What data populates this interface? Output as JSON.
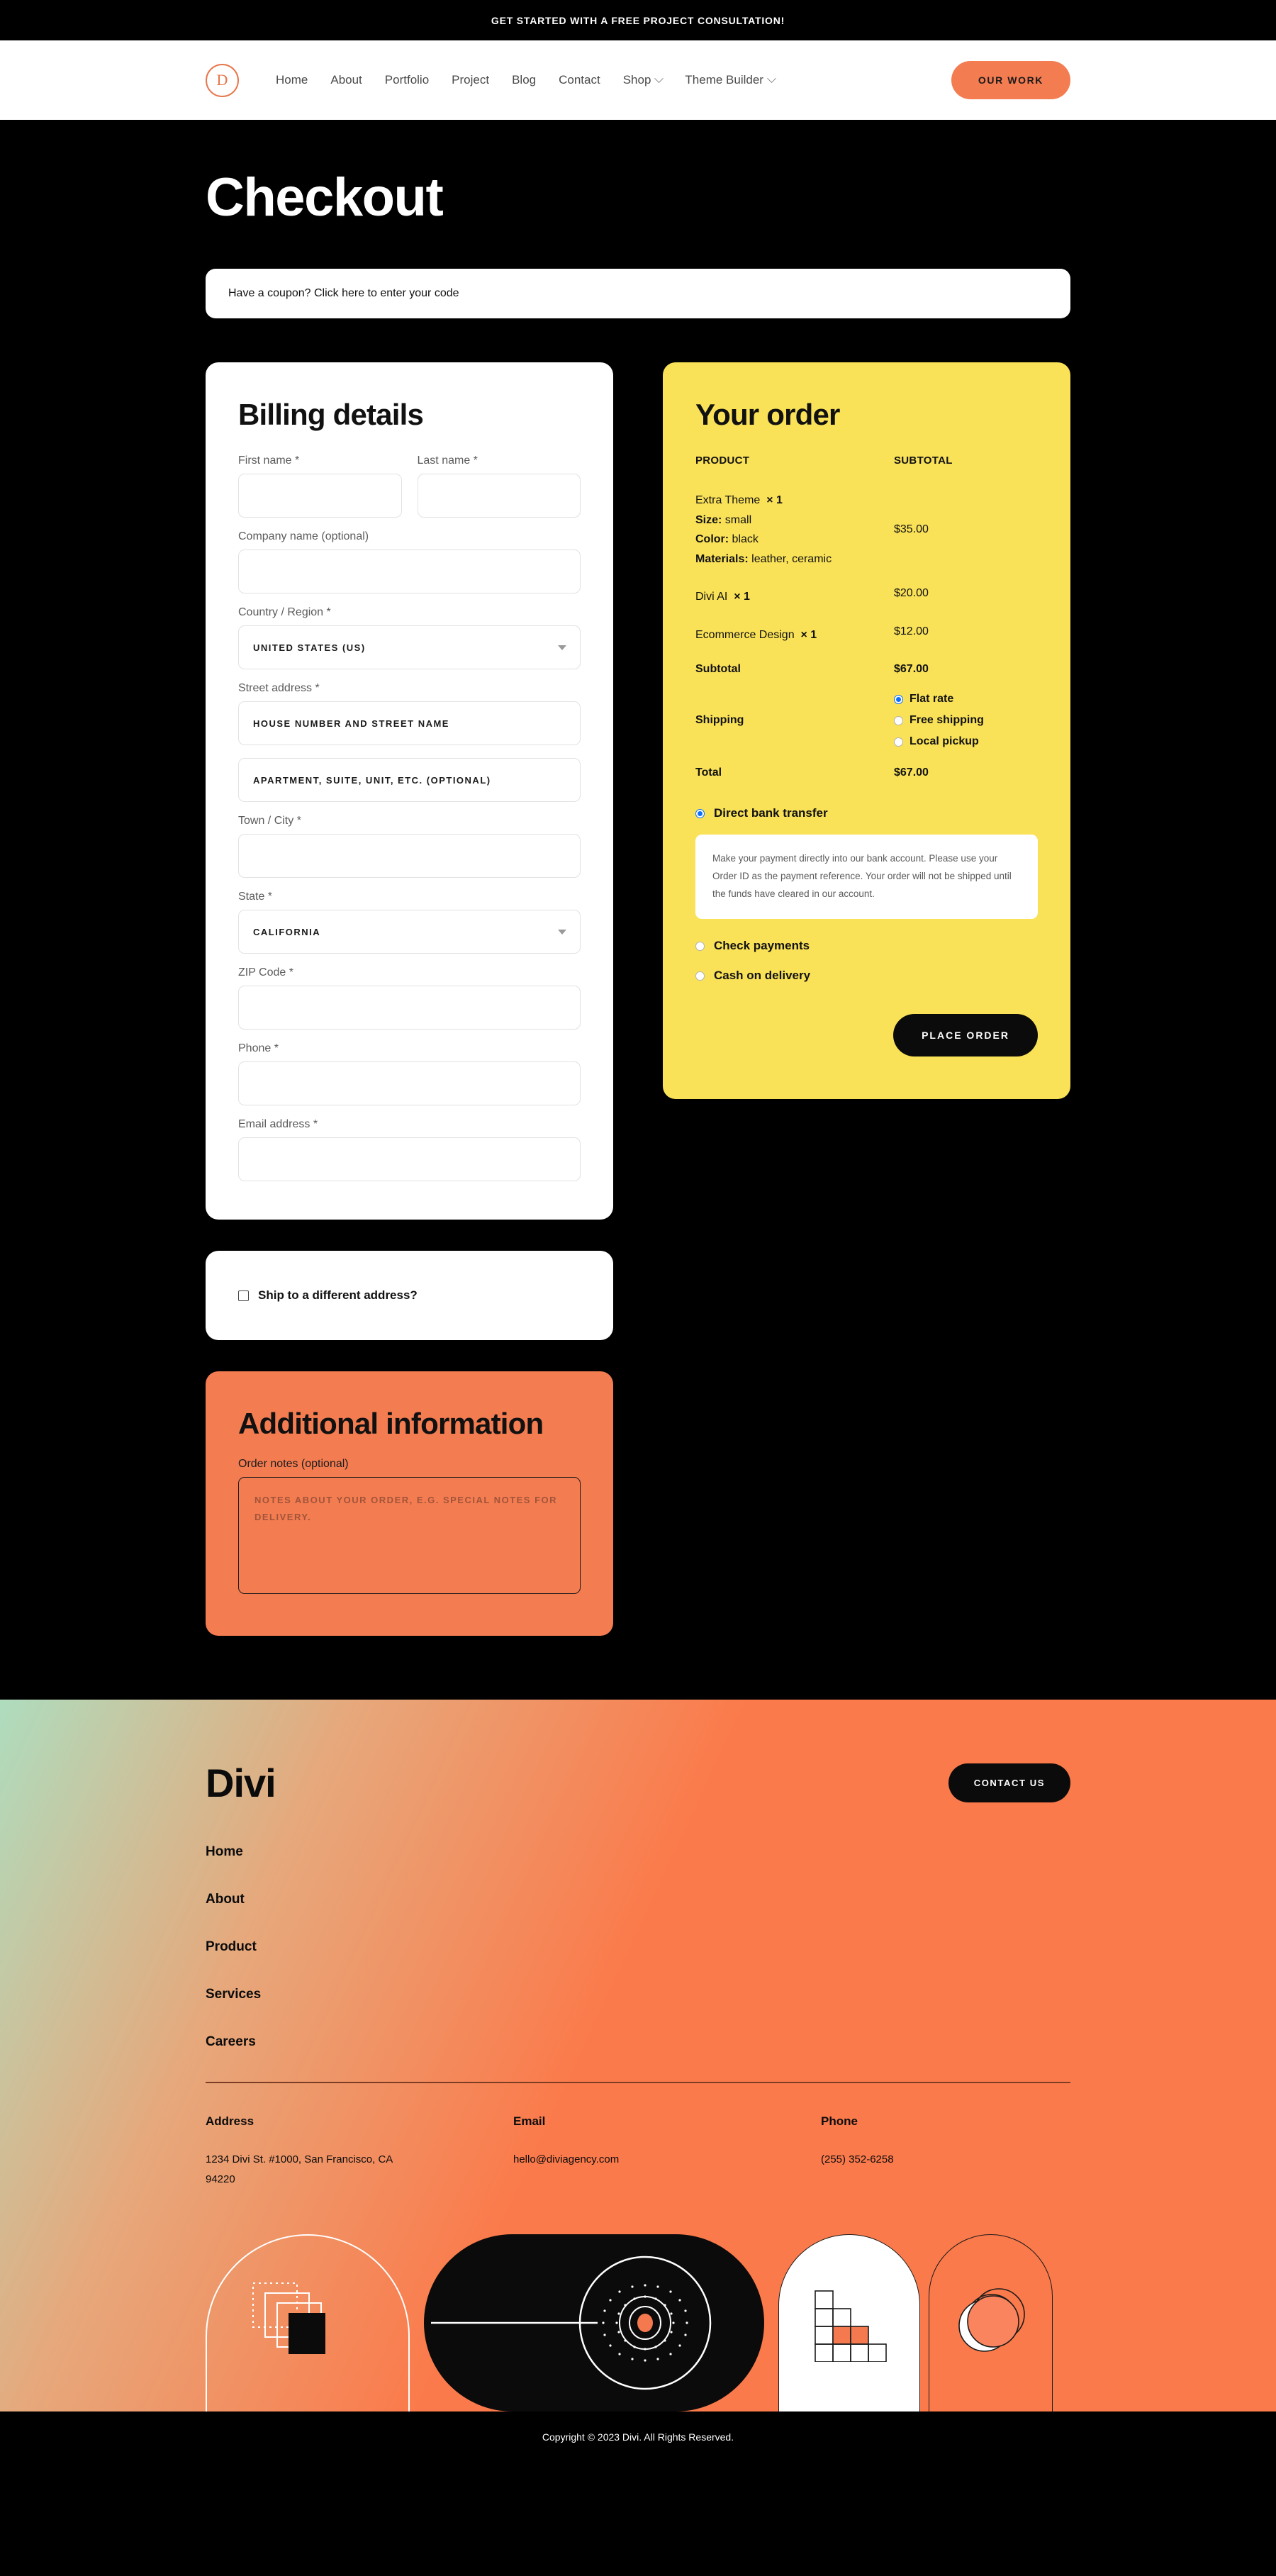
{
  "announcement": {
    "text": "GET STARTED WITH A FREE PROJECT CONSULTATION!"
  },
  "header": {
    "logo_letter": "D",
    "nav": [
      {
        "label": "Home",
        "has_dropdown": false
      },
      {
        "label": "About",
        "has_dropdown": false
      },
      {
        "label": "Portfolio",
        "has_dropdown": false
      },
      {
        "label": "Project",
        "has_dropdown": false
      },
      {
        "label": "Blog",
        "has_dropdown": false
      },
      {
        "label": "Contact",
        "has_dropdown": false
      },
      {
        "label": "Shop",
        "has_dropdown": true
      },
      {
        "label": "Theme Builder",
        "has_dropdown": true
      }
    ],
    "cta_label": "OUR WORK"
  },
  "page": {
    "title": "Checkout",
    "coupon_text": "Have a coupon? Click here to enter your code"
  },
  "billing": {
    "title": "Billing details",
    "fields": {
      "first_name_label": "First name *",
      "first_name_value": "",
      "last_name_label": "Last name *",
      "last_name_value": "",
      "company_label": "Company name (optional)",
      "company_value": "",
      "country_label": "Country / Region *",
      "country_value": "UNITED STATES (US)",
      "street_label": "Street address *",
      "street_placeholder": "HOUSE NUMBER AND STREET NAME",
      "street2_placeholder": "APARTMENT, SUITE, UNIT, ETC. (OPTIONAL)",
      "city_label": "Town / City *",
      "city_value": "",
      "state_label": "State *",
      "state_value": "CALIFORNIA",
      "zip_label": "ZIP Code *",
      "zip_value": "",
      "phone_label": "Phone *",
      "phone_value": "",
      "email_label": "Email address *",
      "email_value": ""
    }
  },
  "ship_different": {
    "label": "Ship to a different address?",
    "checked": false
  },
  "additional": {
    "title": "Additional information",
    "notes_label": "Order notes (optional)",
    "notes_placeholder": "NOTES ABOUT YOUR ORDER, E.G. SPECIAL NOTES FOR DELIVERY.",
    "notes_value": ""
  },
  "order": {
    "title": "Your order",
    "col_product": "PRODUCT",
    "col_subtotal": "SUBTOTAL",
    "items": [
      {
        "name": "Extra Theme",
        "qty": "× 1",
        "meta": [
          {
            "key": "Size:",
            "value": " small"
          },
          {
            "key": "Color:",
            "value": " black"
          },
          {
            "key": "Materials:",
            "value": " leather, ceramic"
          }
        ],
        "price": "$35.00"
      },
      {
        "name": "Divi AI",
        "qty": "× 1",
        "meta": [],
        "price": "$20.00"
      },
      {
        "name": "Ecommerce Design",
        "qty": "× 1",
        "meta": [],
        "price": "$12.00"
      }
    ],
    "subtotal_label": "Subtotal",
    "subtotal_value": "$67.00",
    "shipping_label": "Shipping",
    "shipping_options": [
      {
        "label": "Flat rate",
        "selected": true
      },
      {
        "label": "Free shipping",
        "selected": false
      },
      {
        "label": "Local pickup",
        "selected": false
      }
    ],
    "total_label": "Total",
    "total_value": "$67.00",
    "payment_methods": [
      {
        "label": "Direct bank transfer",
        "selected": true
      },
      {
        "label": "Check payments",
        "selected": false
      },
      {
        "label": "Cash on delivery",
        "selected": false
      }
    ],
    "payment_description": "Make your payment directly into our bank account. Please use your Order ID as the payment reference. Your order will not be shipped until the funds have cleared in our account.",
    "place_order_label": "PLACE ORDER"
  },
  "footer": {
    "logo": "Divi",
    "contact_label": "CONTACT US",
    "links": [
      "Home",
      "About",
      "Product",
      "Services",
      "Careers"
    ],
    "columns": [
      {
        "heading": "Address",
        "value": "1234 Divi St. #1000, San Francisco, CA 94220"
      },
      {
        "heading": "Email",
        "value": "hello@diviagency.com"
      },
      {
        "heading": "Phone",
        "value": "(255) 352-6258"
      }
    ],
    "copyright": "Copyright © 2023 Divi. All Rights Reserved."
  },
  "colors": {
    "black": "#000000",
    "orange": "#F47C51",
    "footer_orange": "#FB7A4B",
    "yellow": "#FAE258",
    "white": "#FFFFFF",
    "radio_blue": "#0D6EFD"
  }
}
